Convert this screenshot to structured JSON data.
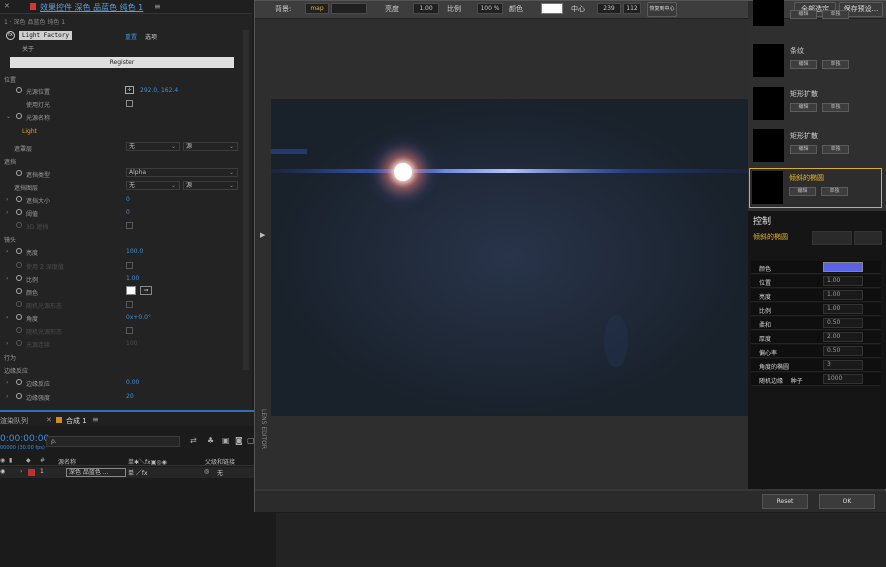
{
  "effects_panel": {
    "tab_title": "效果控件 深色 品蓝色 纯色 1",
    "breadcrumb": "1 · 深色 品蓝色 纯色 1",
    "effect_name": "Light Factory",
    "reset_label": "重置",
    "options_label": "选项",
    "about_label": "关于",
    "register_label": "Register",
    "section_position": "位置",
    "light_position_label": "光源位置",
    "light_position_value": "292.0, 162.4",
    "use_lights_label": "使用灯光",
    "light_name_label": "光源名称",
    "light_name_value": "Light",
    "layer_label": "遮罩层",
    "layer_value_a": "无",
    "layer_value_b": "源",
    "section_mask": "遮挡",
    "mask_type_label": "遮挡类型",
    "mask_type_value": "Alpha",
    "mask_layer_label": "遮挡图层",
    "mask_layer_value_a": "无",
    "mask_layer_value_b": "源",
    "mask_size_label": "遮挡大小",
    "mask_size_value": "0",
    "threshold_label": "阈值",
    "threshold_value": "0",
    "threed_label": "3D 遮挡",
    "section_lens": "镜头",
    "brightness_label": "亮度",
    "brightness_value": "100.0",
    "dim_label_1": "使用 Z 深度值",
    "scale_label": "比例",
    "scale_value": "1.00",
    "color_label": "颜色",
    "angle_label": "角度",
    "angle_value": "0x+0.0°",
    "dim_label_2": "随机光源形态",
    "dim_label_3": "光源连续",
    "dim_value_3": "100",
    "section_behavior": "行为",
    "section_edge": "边缘反应",
    "edge_reaction_label": "边缘反应",
    "edge_reaction_value": "0.00",
    "edge_strength_label": "边缘强度",
    "edge_strength_value": "20"
  },
  "timeline": {
    "render_queue_tab": "渲染队列",
    "comp_tab": "合成 1",
    "timecode": "0:00:00:00",
    "frame_info": "00000 (30.00 fps)",
    "search_placeholder": "ρ.",
    "col_source_name": "源名称",
    "col_switches": "单✱＼fx▣◎◉",
    "col_parent": "父级和链接",
    "layer_index": "1",
    "layer_name": "深色 品蓝色 ...",
    "layer_switches": "单 ／fx",
    "layer_parent_icon": "◎",
    "layer_parent": "无"
  },
  "dialog": {
    "background_label": "背景:",
    "background_value": "map",
    "brightness_label": "亮度",
    "brightness_value": "1.00",
    "scale_label": "比例",
    "scale_value": "100 %",
    "color_label": "颜色",
    "center_label": "中心",
    "center_x": "239",
    "center_y": "112",
    "restore_center_label": "恢复到中心",
    "select_all_label": "全部选定",
    "save_preset_label": "保存预设...",
    "side_tab_label": "LENS EDITOR",
    "presets": [
      {
        "name": "",
        "btn1": "编辑",
        "btn2": "单独"
      },
      {
        "name": "条纹",
        "btn1": "编辑",
        "btn2": "单独"
      },
      {
        "name": "矩形扩散",
        "btn1": "编辑",
        "btn2": "单独"
      },
      {
        "name": "矩形扩散",
        "btn1": "编辑",
        "btn2": "单独"
      },
      {
        "name": "倾斜的椭圆",
        "btn1": "编辑",
        "btn2": "单独"
      }
    ],
    "control_header": "控制",
    "control_subject": "倾斜的椭圆",
    "controls": [
      {
        "label": "颜色",
        "value": ""
      },
      {
        "label": "位置",
        "value": "1.00"
      },
      {
        "label": "亮度",
        "value": "1.00"
      },
      {
        "label": "比例",
        "value": "1.00"
      },
      {
        "label": "柔和",
        "value": "0.50"
      },
      {
        "label": "厚度",
        "value": "2.00"
      },
      {
        "label": "偏心率",
        "value": "0.50"
      },
      {
        "label": "角度的椭圆",
        "value": "3"
      },
      {
        "label": "随机边缘    种子",
        "value": "1000"
      }
    ],
    "reset_button": "Reset",
    "ok_button": "OK"
  },
  "colors": {
    "accent_blue": "#3f8fd6",
    "selected_border": "#d8ae37",
    "preset_title": "#e8b32a",
    "control_swatch": "#5a63e6"
  }
}
